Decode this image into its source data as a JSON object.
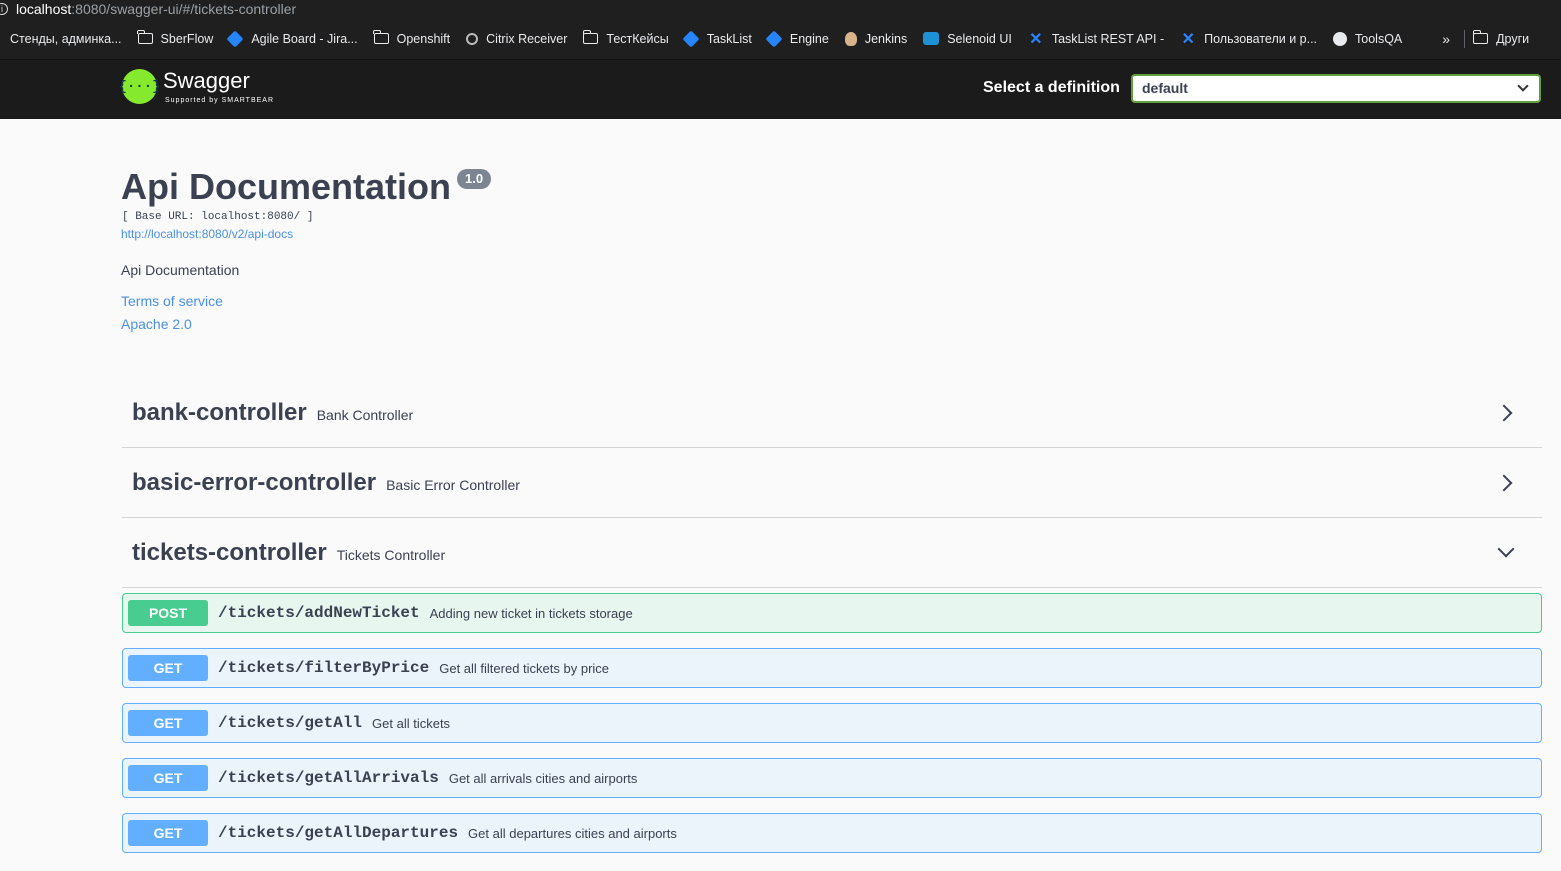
{
  "browser": {
    "url_host": "localhost",
    "url_rest": ":8080/swagger-ui/#/tickets-controller",
    "bookmarks": [
      {
        "label": "Стенды, админка...",
        "icon": "none"
      },
      {
        "label": "SberFlow",
        "icon": "folder-icon"
      },
      {
        "label": "Agile Board - Jira...",
        "icon": "jira-icon"
      },
      {
        "label": "Openshift",
        "icon": "folder-icon"
      },
      {
        "label": "Citrix Receiver",
        "icon": "citrix-icon"
      },
      {
        "label": "ТестКейсы",
        "icon": "folder-icon"
      },
      {
        "label": "TaskList",
        "icon": "jira-icon"
      },
      {
        "label": "Engine",
        "icon": "jira-icon"
      },
      {
        "label": "Jenkins",
        "icon": "jenkins-icon"
      },
      {
        "label": "Selenoid UI",
        "icon": "selenoid-icon"
      },
      {
        "label": "TaskList REST API -",
        "icon": "confluence-icon"
      },
      {
        "label": "Пользователи и р...",
        "icon": "confluence-icon"
      },
      {
        "label": "ToolsQA",
        "icon": "globe-icon"
      }
    ],
    "more": "»",
    "other_bookmarks": "Други"
  },
  "topbar": {
    "logo_name": "Swagger",
    "logo_sub": "Supported by SMARTBEAR",
    "select_label": "Select a definition",
    "select_value": "default"
  },
  "info": {
    "title": "Api Documentation",
    "version": "1.0",
    "base_url": "[ Base URL: localhost:8080/ ]",
    "spec_url": "http://localhost:8080/v2/api-docs",
    "description": "Api Documentation",
    "terms": "Terms of service",
    "license": "Apache 2.0"
  },
  "tags": [
    {
      "name": "bank-controller",
      "desc": "Bank Controller",
      "expanded": false
    },
    {
      "name": "basic-error-controller",
      "desc": "Basic Error Controller",
      "expanded": false
    },
    {
      "name": "tickets-controller",
      "desc": "Tickets Controller",
      "expanded": true
    }
  ],
  "operations": [
    {
      "method": "POST",
      "path": "/tickets/addNewTicket",
      "summary": "Adding new ticket in tickets storage"
    },
    {
      "method": "GET",
      "path": "/tickets/filterByPrice",
      "summary": "Get all filtered tickets by price"
    },
    {
      "method": "GET",
      "path": "/tickets/getAll",
      "summary": "Get all tickets"
    },
    {
      "method": "GET",
      "path": "/tickets/getAllArrivals",
      "summary": "Get all arrivals cities and airports"
    },
    {
      "method": "GET",
      "path": "/tickets/getAllDepartures",
      "summary": "Get all departures cities and airports"
    }
  ],
  "colors": {
    "post": "#49cc90",
    "get": "#61affe",
    "swagger_green": "#85ea2d"
  }
}
